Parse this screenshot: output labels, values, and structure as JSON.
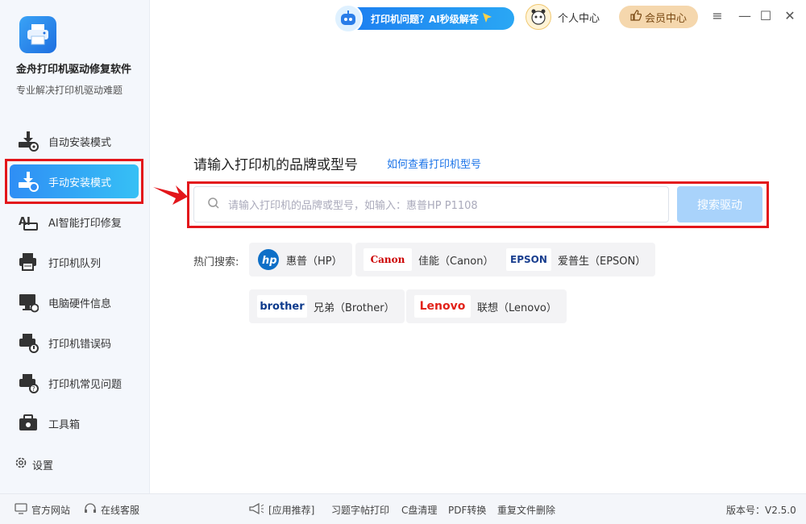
{
  "app": {
    "name": "金舟打印机驱动修复软件",
    "subtitle": "专业解决打印机驱动难题"
  },
  "sidebar": {
    "items": [
      {
        "label": "自动安装模式",
        "icon": "auto-install-icon"
      },
      {
        "label": "手动安装模式",
        "icon": "manual-install-icon",
        "active": true
      },
      {
        "label": "AI智能打印修复",
        "icon": "ai-repair-icon"
      },
      {
        "label": "打印机队列",
        "icon": "printer-queue-icon"
      },
      {
        "label": "电脑硬件信息",
        "icon": "hardware-info-icon"
      },
      {
        "label": "打印机错误码",
        "icon": "error-code-icon"
      },
      {
        "label": "打印机常见问题",
        "icon": "faq-icon"
      },
      {
        "label": "工具箱",
        "icon": "toolbox-icon"
      }
    ],
    "settings_label": "设置"
  },
  "topbar": {
    "ai_label": "打印机问题？AI秒级解答",
    "personal_label": "个人中心",
    "member_label": "会员中心"
  },
  "main": {
    "heading": "请输入打印机的品牌或型号",
    "howto_link": "如何查看打印机型号",
    "search_placeholder": "请输入打印机的品牌或型号，如输入：惠普HP P1108",
    "search_button": "搜索驱动",
    "hot_label": "热门搜索:",
    "hot_brands": [
      {
        "logo": "hp",
        "label": "惠普（HP）"
      },
      {
        "logo": "Canon",
        "label": "佳能（Canon）"
      },
      {
        "logo": "EPSON",
        "label": "爱普生（EPSON）"
      },
      {
        "logo": "brother",
        "label": "兄弟（Brother）"
      },
      {
        "logo": "Lenovo",
        "label": "联想（Lenovo）"
      }
    ]
  },
  "footer": {
    "website": "官方网站",
    "support": "在线客服",
    "recommend": "[应用推荐]",
    "links": [
      "习题字帖打印",
      "C盘清理",
      "PDF转换",
      "重复文件删除"
    ],
    "version": "版本号：V2.5.0"
  },
  "colors": {
    "accent": "#2f8ef5",
    "highlight_red": "#e3161b",
    "search_button": "#a9d3fb",
    "member": "#f5d7ad"
  }
}
